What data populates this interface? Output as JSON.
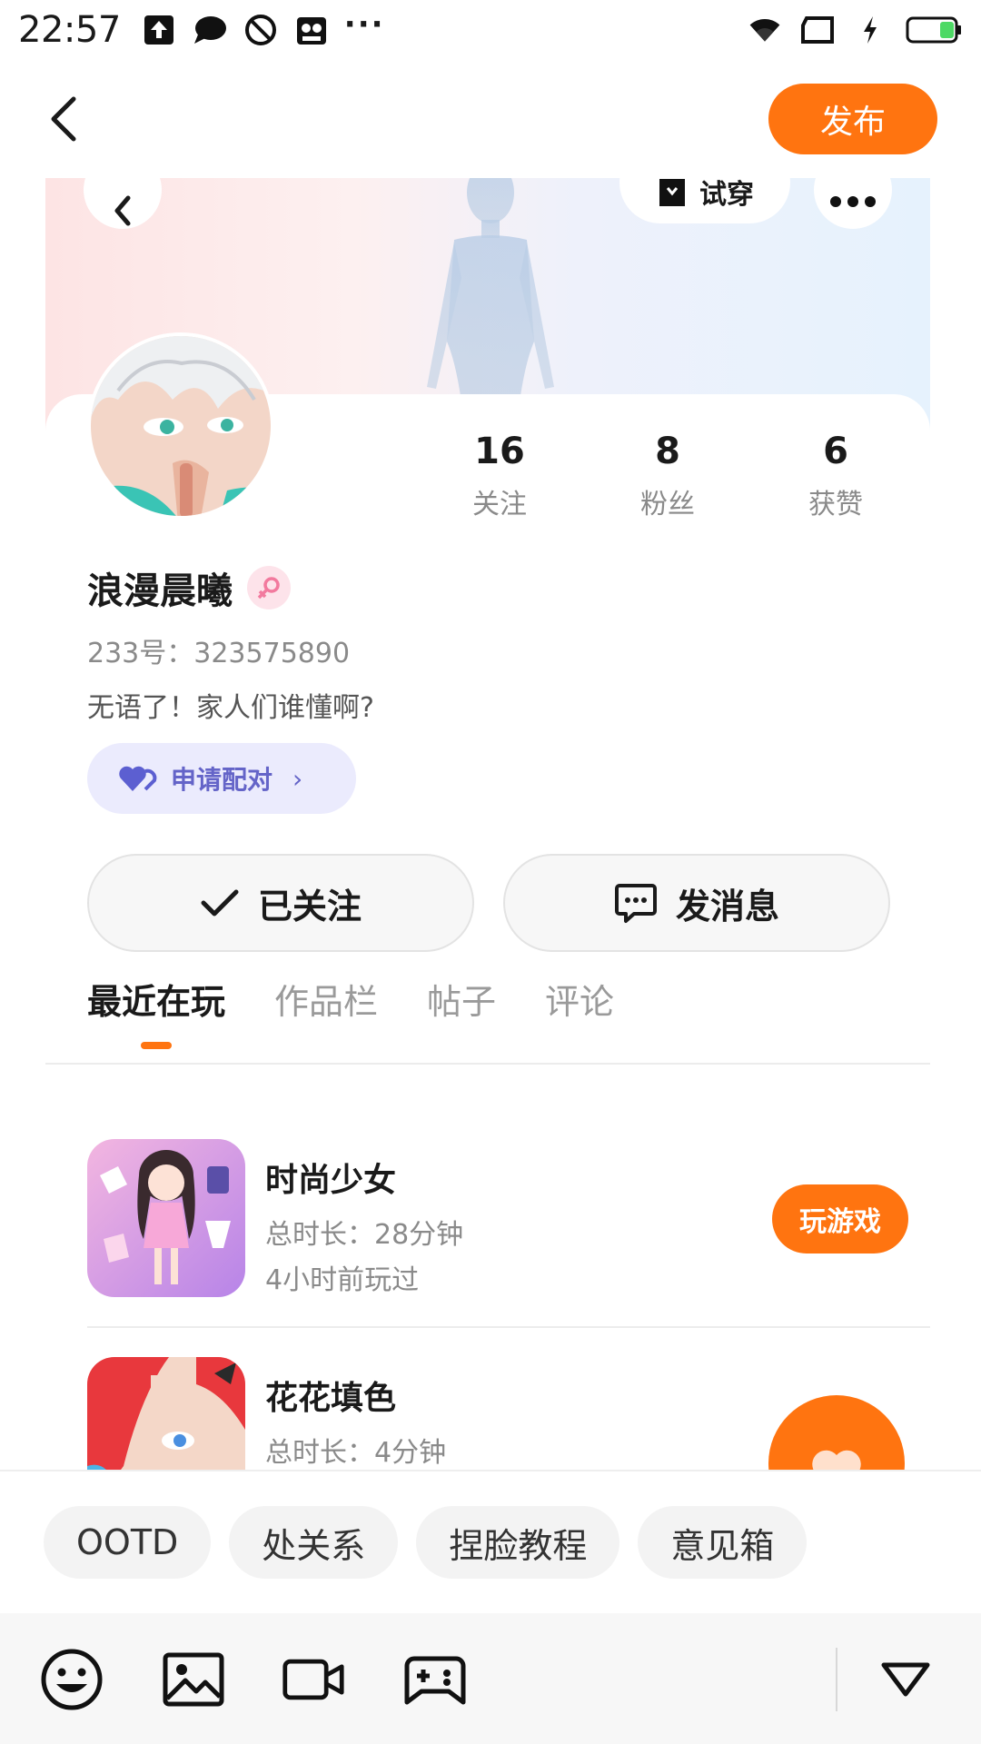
{
  "status_bar": {
    "time": "22:57",
    "icons": [
      "upload-icon",
      "chat-bubble-icon",
      "block-icon",
      "cat-icon",
      "more-dots-icon",
      "wifi-icon",
      "screen-cast-icon",
      "charging-icon",
      "battery-icon"
    ]
  },
  "topbar": {
    "publish_label": "发布"
  },
  "card": {
    "tryon_label": "试穿",
    "stats": [
      {
        "value": "16",
        "label": "关注"
      },
      {
        "value": "8",
        "label": "粉丝"
      },
      {
        "value": "6",
        "label": "获赞"
      }
    ],
    "username": "浪漫晨曦",
    "uid": "233号：323575890",
    "bio": "无语了！家人们谁懂啊?",
    "pair_label": "申请配对",
    "followed_label": "已关注",
    "message_label": "发消息",
    "tabs": [
      "最近在玩",
      "作品栏",
      "帖子",
      "评论"
    ],
    "games": [
      {
        "title": "时尚少女",
        "duration": "总时长：28分钟",
        "last_played": "4小时前玩过",
        "button": "玩游戏"
      },
      {
        "title": "花花填色",
        "duration": "总时长：4分钟"
      }
    ]
  },
  "chips": [
    "OOTD",
    "处关系",
    "捏脸教程",
    "意见箱"
  ],
  "colors": {
    "accent": "#ff7410",
    "pair_bg": "#ebebfd",
    "pair_text": "#6464c8"
  }
}
